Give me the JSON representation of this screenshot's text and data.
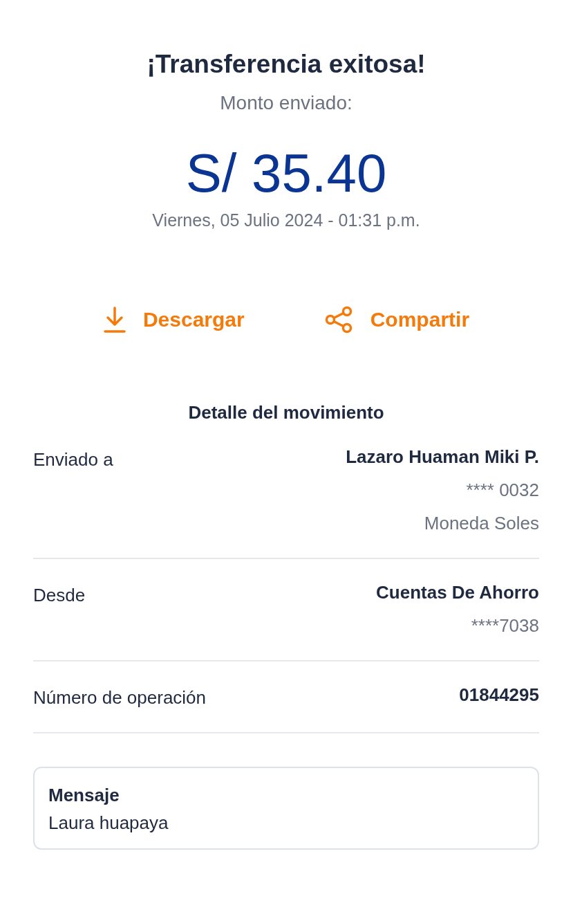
{
  "title": "¡Transferencia exitosa!",
  "amount_label": "Monto enviado:",
  "amount": "S/ 35.40",
  "date": "Viernes, 05 Julio 2024 - 01:31 p.m.",
  "actions": [
    {
      "kind": "download",
      "label": "Descargar"
    },
    {
      "kind": "share",
      "label": "Compartir"
    }
  ],
  "detail_title": "Detalle del movimiento",
  "details": [
    {
      "label": "Enviado a",
      "values": [
        {
          "kind": "primary",
          "text": "Lazaro Huaman Miki P."
        },
        {
          "kind": "secondary",
          "text": "**** 0032"
        },
        {
          "kind": "secondary",
          "text": "Moneda Soles"
        }
      ]
    },
    {
      "label": "Desde",
      "values": [
        {
          "kind": "primary",
          "text": "Cuentas De Ahorro"
        },
        {
          "kind": "secondary",
          "text": "****7038"
        }
      ]
    },
    {
      "label": "Número de operación",
      "values": [
        {
          "kind": "primary",
          "text": "01844295"
        }
      ]
    }
  ],
  "message": {
    "label": "Mensaje",
    "text": "Laura huapaya"
  }
}
